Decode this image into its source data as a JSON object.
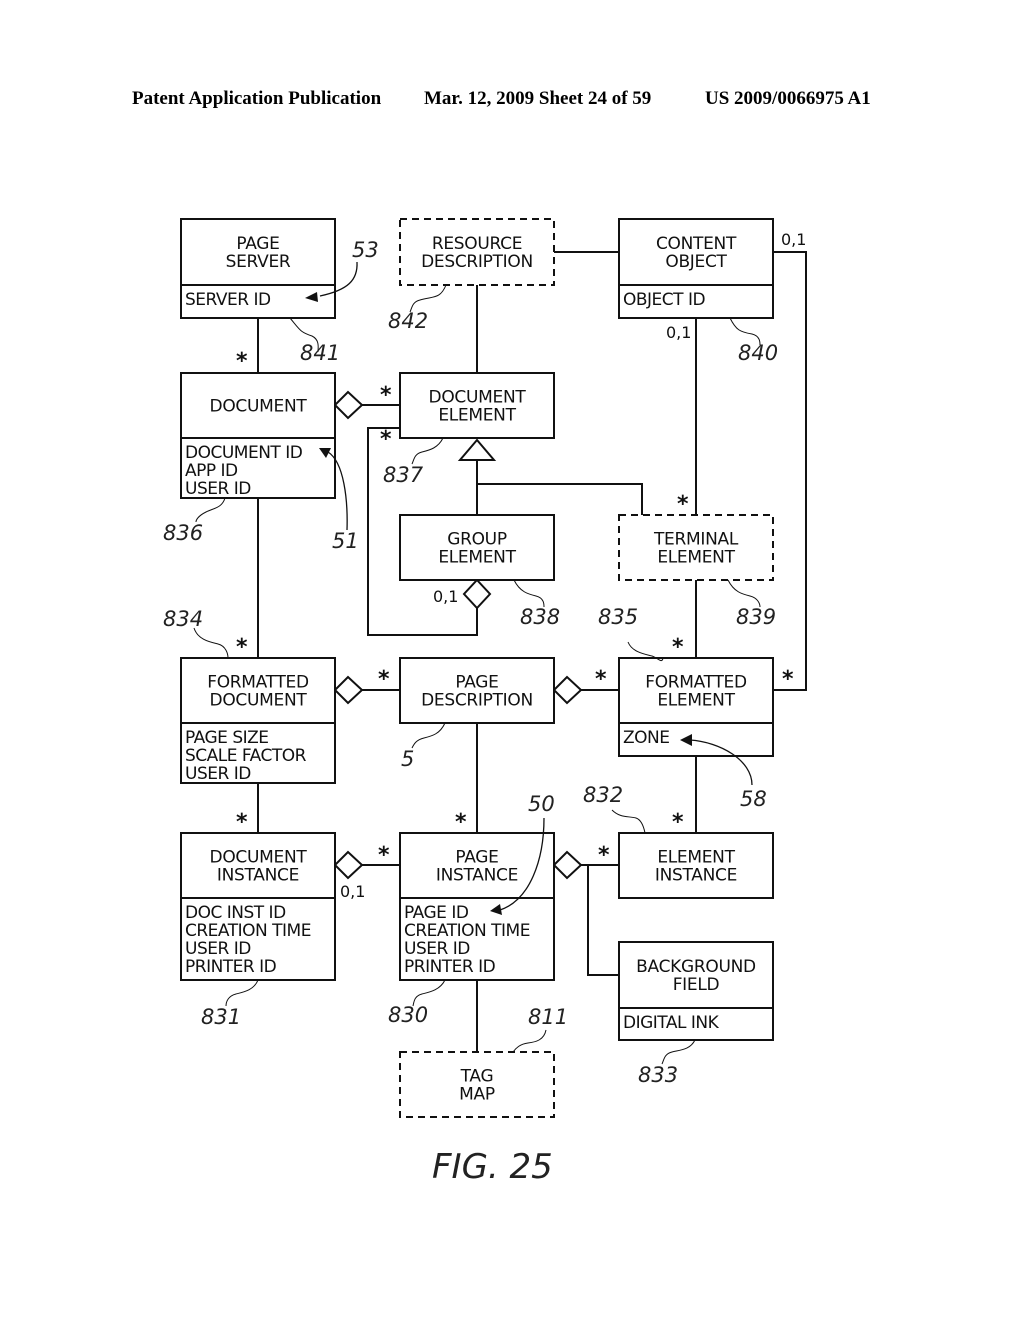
{
  "header": {
    "left": "Patent Application Publication",
    "middle": "Mar. 12, 2009  Sheet 24 of 59",
    "right": "US 2009/0066975 A1"
  },
  "figure": {
    "caption": "FIG. 25"
  },
  "boxes": {
    "page_server": {
      "title": [
        "PAGE",
        "SERVER"
      ],
      "attributes": [
        "SERVER ID"
      ],
      "ref": "841",
      "style": "solid"
    },
    "resource_description": {
      "title": [
        "RESOURCE",
        "DESCRIPTION"
      ],
      "attributes": [],
      "ref": "842",
      "style": "dashed"
    },
    "content_object": {
      "title": [
        "CONTENT",
        "OBJECT"
      ],
      "attributes": [
        "OBJECT ID"
      ],
      "ref": "840",
      "style": "solid"
    },
    "document": {
      "title": [
        "DOCUMENT"
      ],
      "attributes": [
        "DOCUMENT ID",
        "APP ID",
        "USER ID"
      ],
      "ref": "836",
      "style": "solid"
    },
    "document_element": {
      "title": [
        "DOCUMENT",
        "ELEMENT"
      ],
      "attributes": [],
      "ref": "837",
      "style": "solid"
    },
    "group_element": {
      "title": [
        "GROUP",
        "ELEMENT"
      ],
      "attributes": [],
      "ref": "838",
      "style": "solid"
    },
    "terminal_element": {
      "title": [
        "TERMINAL",
        "ELEMENT"
      ],
      "attributes": [],
      "ref": "839",
      "style": "dashed"
    },
    "formatted_document": {
      "title": [
        "FORMATTED",
        "DOCUMENT"
      ],
      "attributes": [
        "PAGE SIZE",
        "SCALE FACTOR",
        "USER ID"
      ],
      "ref": "834",
      "style": "solid"
    },
    "page_description": {
      "title": [
        "PAGE",
        "DESCRIPTION"
      ],
      "attributes": [],
      "ref": "5",
      "style": "solid"
    },
    "formatted_element": {
      "title": [
        "FORMATTED",
        "ELEMENT"
      ],
      "attributes": [
        "ZONE"
      ],
      "ref": "835",
      "style": "solid"
    },
    "document_instance": {
      "title": [
        "DOCUMENT",
        "INSTANCE"
      ],
      "attributes": [
        "DOC INST ID",
        "CREATION TIME",
        "USER ID",
        "PRINTER ID"
      ],
      "ref": "831",
      "style": "solid"
    },
    "page_instance": {
      "title": [
        "PAGE",
        "INSTANCE"
      ],
      "attributes": [
        "PAGE ID",
        "CREATION TIME",
        "USER ID",
        "PRINTER ID"
      ],
      "ref": "830",
      "style": "solid"
    },
    "element_instance": {
      "title": [
        "ELEMENT",
        "INSTANCE"
      ],
      "attributes": [],
      "ref": "832",
      "style": "solid"
    },
    "background_field": {
      "title": [
        "BACKGROUND",
        "FIELD"
      ],
      "attributes": [
        "DIGITAL INK"
      ],
      "ref": "833",
      "style": "solid"
    },
    "tag_map": {
      "title": [
        "TAG",
        "MAP"
      ],
      "attributes": [],
      "ref": "811",
      "style": "dashed"
    }
  },
  "attribute_refs": {
    "server_id": "53",
    "document_id": "51",
    "zone": "58",
    "page_id": "50"
  },
  "multiplicities": {
    "many": "*",
    "zero_or_one": "0,1"
  }
}
